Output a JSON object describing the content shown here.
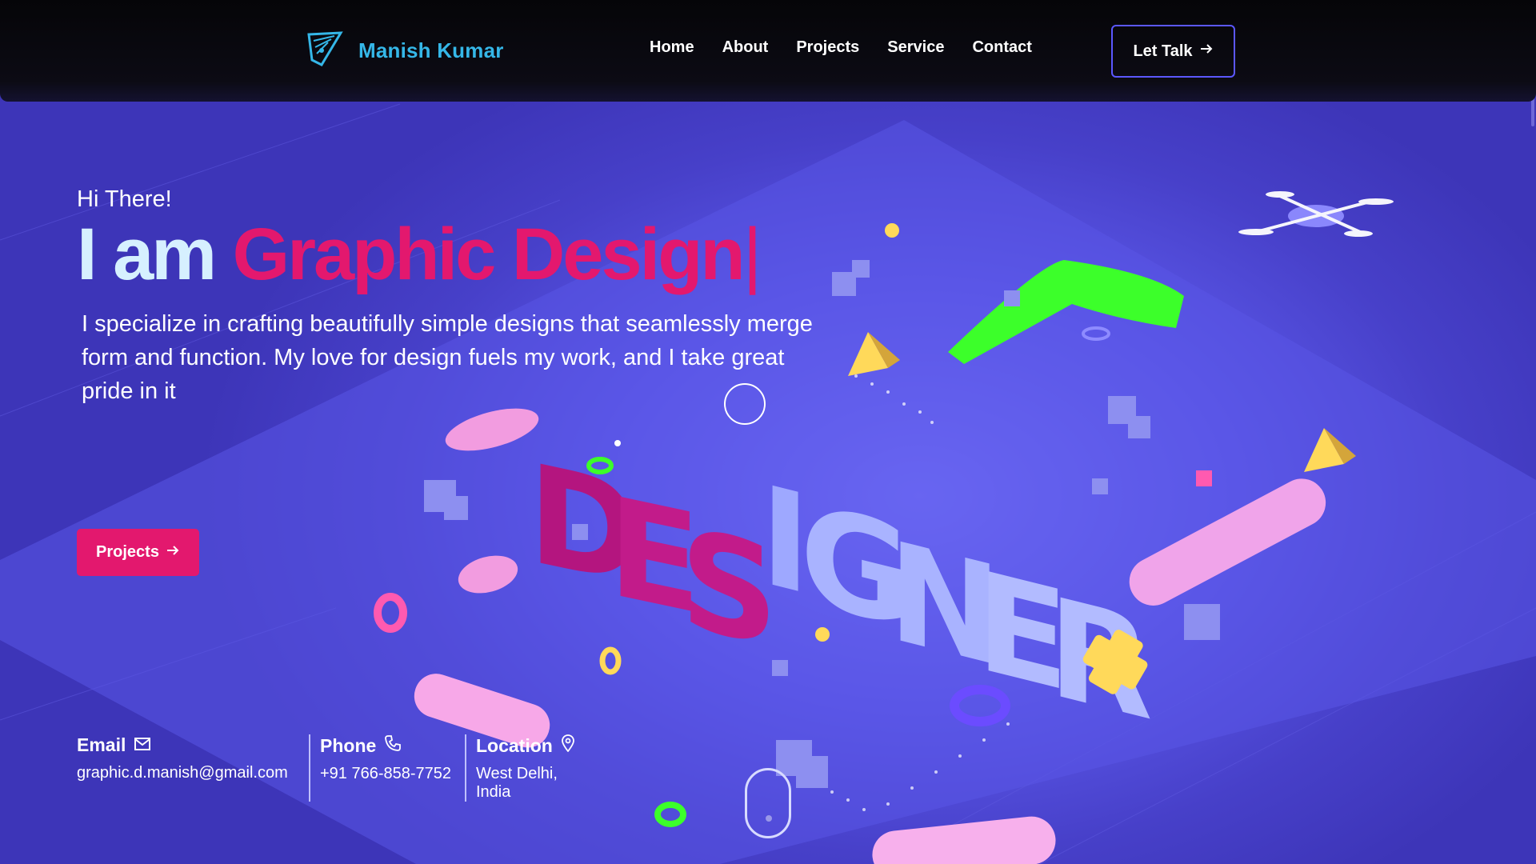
{
  "brand": {
    "title": "Manish Kumar",
    "logo_icon": "pen-nib-logo-icon",
    "color": "#35b7e8"
  },
  "nav": {
    "items": [
      {
        "label": "Home"
      },
      {
        "label": "About"
      },
      {
        "label": "Projects"
      },
      {
        "label": "Service"
      },
      {
        "label": "Contact"
      }
    ],
    "cta_label": "Let Talk",
    "cta_icon": "arrow-right-icon",
    "cta_border_color": "#5b57ff"
  },
  "hero": {
    "greeting": "Hi There!",
    "headline_lead": "I am",
    "headline_typed": "Graphic Design",
    "caret": "|",
    "intro": "I specialize in crafting beautifully simple designs that seamlessly merge form and function. My love for design fuels my work, and I take great pride in it",
    "button_label": "Projects",
    "button_icon": "arrow-right-icon",
    "accent_color": "#e3186e"
  },
  "contacts": [
    {
      "label": "Email",
      "icon": "mail-icon",
      "value": "graphic.d.manish@gmail.com"
    },
    {
      "label": "Phone",
      "icon": "phone-icon",
      "value": "+91 766-858-7752"
    },
    {
      "label": "Location",
      "icon": "location-pin-icon",
      "value": "West Delhi, India"
    }
  ],
  "illustration": {
    "text": "DESIGNER",
    "background_color": "#4a44c8"
  }
}
